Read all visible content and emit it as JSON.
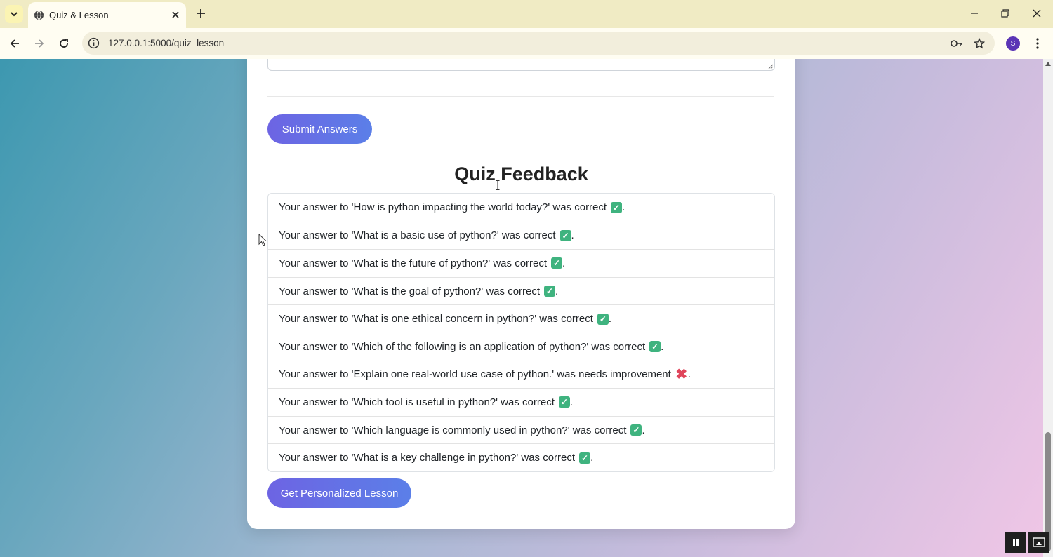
{
  "browser": {
    "tab_title": "Quiz & Lesson",
    "url": "127.0.0.1:5000/quiz_lesson",
    "profile_initial": "S"
  },
  "page": {
    "submit_label": "Submit Answers",
    "feedback_title": "Quiz Feedback",
    "feedback": [
      {
        "text": "Your answer to 'How is python impacting the world today?' was correct",
        "status": "correct"
      },
      {
        "text": "Your answer to 'What is a basic use of python?' was correct",
        "status": "correct"
      },
      {
        "text": "Your answer to 'What is the future of python?' was correct",
        "status": "correct"
      },
      {
        "text": "Your answer to 'What is the goal of python?' was correct",
        "status": "correct"
      },
      {
        "text": "Your answer to 'What is one ethical concern in python?' was correct",
        "status": "correct"
      },
      {
        "text": "Your answer to 'Which of the following is an application of python?' was correct",
        "status": "correct"
      },
      {
        "text": "Your answer to 'Explain one real-world use case of python.' was needs improvement",
        "status": "incorrect"
      },
      {
        "text": "Your answer to 'Which tool is useful in python?' was correct",
        "status": "correct"
      },
      {
        "text": "Your answer to 'Which language is commonly used in python?' was correct",
        "status": "correct"
      },
      {
        "text": "Your answer to 'What is a key challenge in python?' was correct",
        "status": "correct"
      }
    ],
    "lesson_label": "Get Personalized Lesson"
  },
  "colors": {
    "button_start": "#6d64e3",
    "button_end": "#5b7fe8",
    "correct_mark": "#3fb37f",
    "incorrect_mark": "#e0455b"
  }
}
